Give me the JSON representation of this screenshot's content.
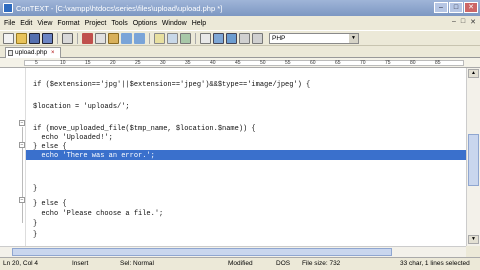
{
  "window": {
    "title": "ConTEXT - [C:\\xampp\\htdocs\\series\\files\\upload\\upload.php *]"
  },
  "menu": [
    "File",
    "Edit",
    "View",
    "Format",
    "Project",
    "Tools",
    "Options",
    "Window",
    "Help"
  ],
  "toolbar": {
    "language": "PHP"
  },
  "tab": {
    "label": "upload.php"
  },
  "ruler": {
    "marks": [
      "5",
      "10",
      "15",
      "20",
      "25",
      "30",
      "35",
      "40",
      "45",
      "50",
      "55",
      "60",
      "65",
      "70",
      "75",
      "80",
      "85"
    ]
  },
  "code": [
    "if ($extension=='jpg'||$extension=='jpeg')&&$type=='image/jpeg') {",
    "",
    "$location = 'uploads/';",
    "",
    "if (move_uploaded_file($tmp_name, $location.$name)) {",
    "  echo 'Uploaded!';",
    "} else {",
    "  echo 'There was an error.';",
    "",
    "",
    "}",
    "",
    "} else {",
    "  echo 'Please choose a file.';",
    "}",
    "}"
  ],
  "status": {
    "position": "Ln 20, Col 4",
    "mode": "Insert",
    "sel": "Sel: Normal",
    "modified": "Modified",
    "format": "DOS",
    "filesize": "File size: 732",
    "chars": "33 char, 1 lines selected"
  }
}
